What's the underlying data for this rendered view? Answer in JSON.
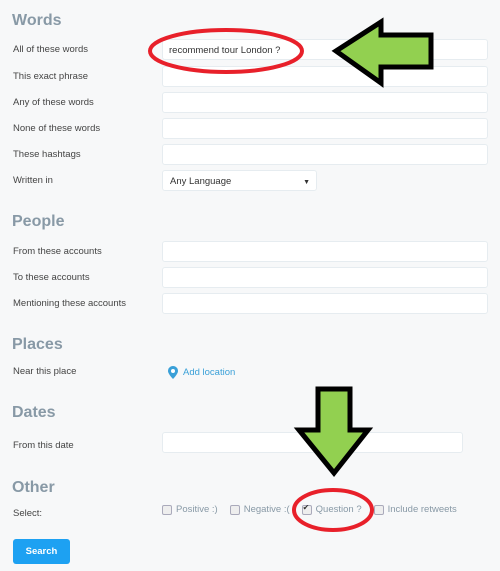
{
  "sections": {
    "words": "Words",
    "people": "People",
    "places": "Places",
    "dates": "Dates",
    "other": "Other"
  },
  "words": {
    "all_label": "All of these words",
    "all_value": "recommend tour London ?",
    "exact_label": "This exact phrase",
    "exact_value": "",
    "any_label": "Any of these words",
    "any_value": "",
    "none_label": "None of these words",
    "none_value": "",
    "hashtags_label": "These hashtags",
    "hashtags_value": "",
    "language_label": "Written in",
    "language_value": "Any Language"
  },
  "people": {
    "from_label": "From these accounts",
    "to_label": "To these accounts",
    "mentioning_label": "Mentioning these accounts"
  },
  "places": {
    "near_label": "Near this place",
    "add_location": "Add location",
    "icon": "map-pin-icon"
  },
  "dates": {
    "from_label": "From this date"
  },
  "other": {
    "select_label": "Select:",
    "checkboxes": [
      {
        "label": "Positive :)",
        "checked": false
      },
      {
        "label": "Negative :(",
        "checked": false
      },
      {
        "label": "Question ?",
        "checked": true
      },
      {
        "label": "Include retweets",
        "checked": false
      }
    ]
  },
  "search_button": "Search",
  "annotations": {
    "arrow_color": "#92d050",
    "circle_color": "#e8202a"
  }
}
